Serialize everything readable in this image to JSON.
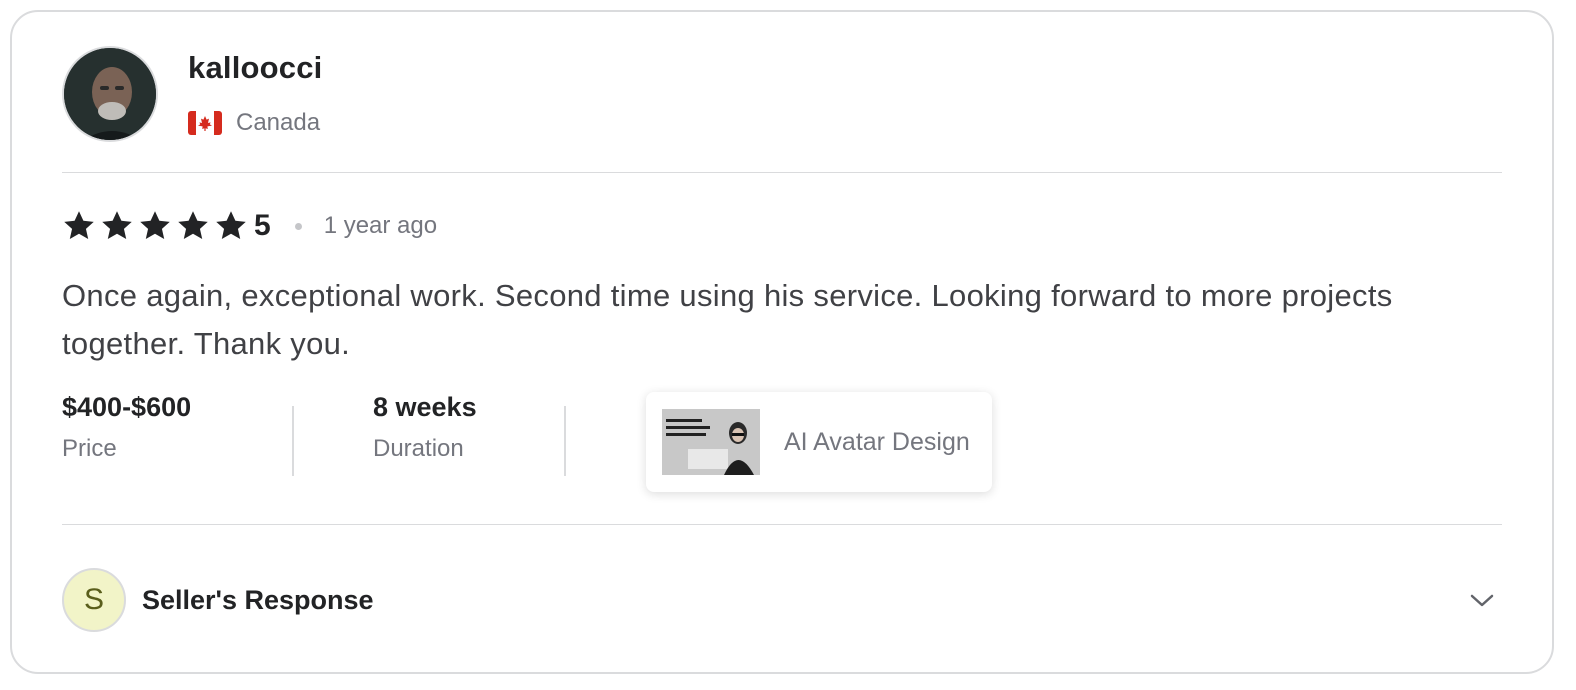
{
  "reviewer": {
    "username": "kalloocci",
    "country": "Canada",
    "avatar_icon": "avatar-photo",
    "flag_icon": "canada-flag-icon"
  },
  "review": {
    "rating_value": "5",
    "stars": 5,
    "time_ago": "1 year ago",
    "text": "Once again, exceptional work. Second time using his service. Looking forward to more projects together. Thank you."
  },
  "meta": {
    "price_value": "$400-$600",
    "price_label": "Price",
    "duration_value": "8 weeks",
    "duration_label": "Duration"
  },
  "gig": {
    "title": "AI Avatar Design"
  },
  "seller_response": {
    "avatar_letter": "S",
    "label": "Seller's Response",
    "toggle_icon": "chevron-down-icon"
  },
  "colors": {
    "text_dark": "#222325",
    "text_muted": "#74767e",
    "star": "#222325",
    "border": "#dadbdd",
    "seller_avatar_bg": "#f2f4c8"
  }
}
